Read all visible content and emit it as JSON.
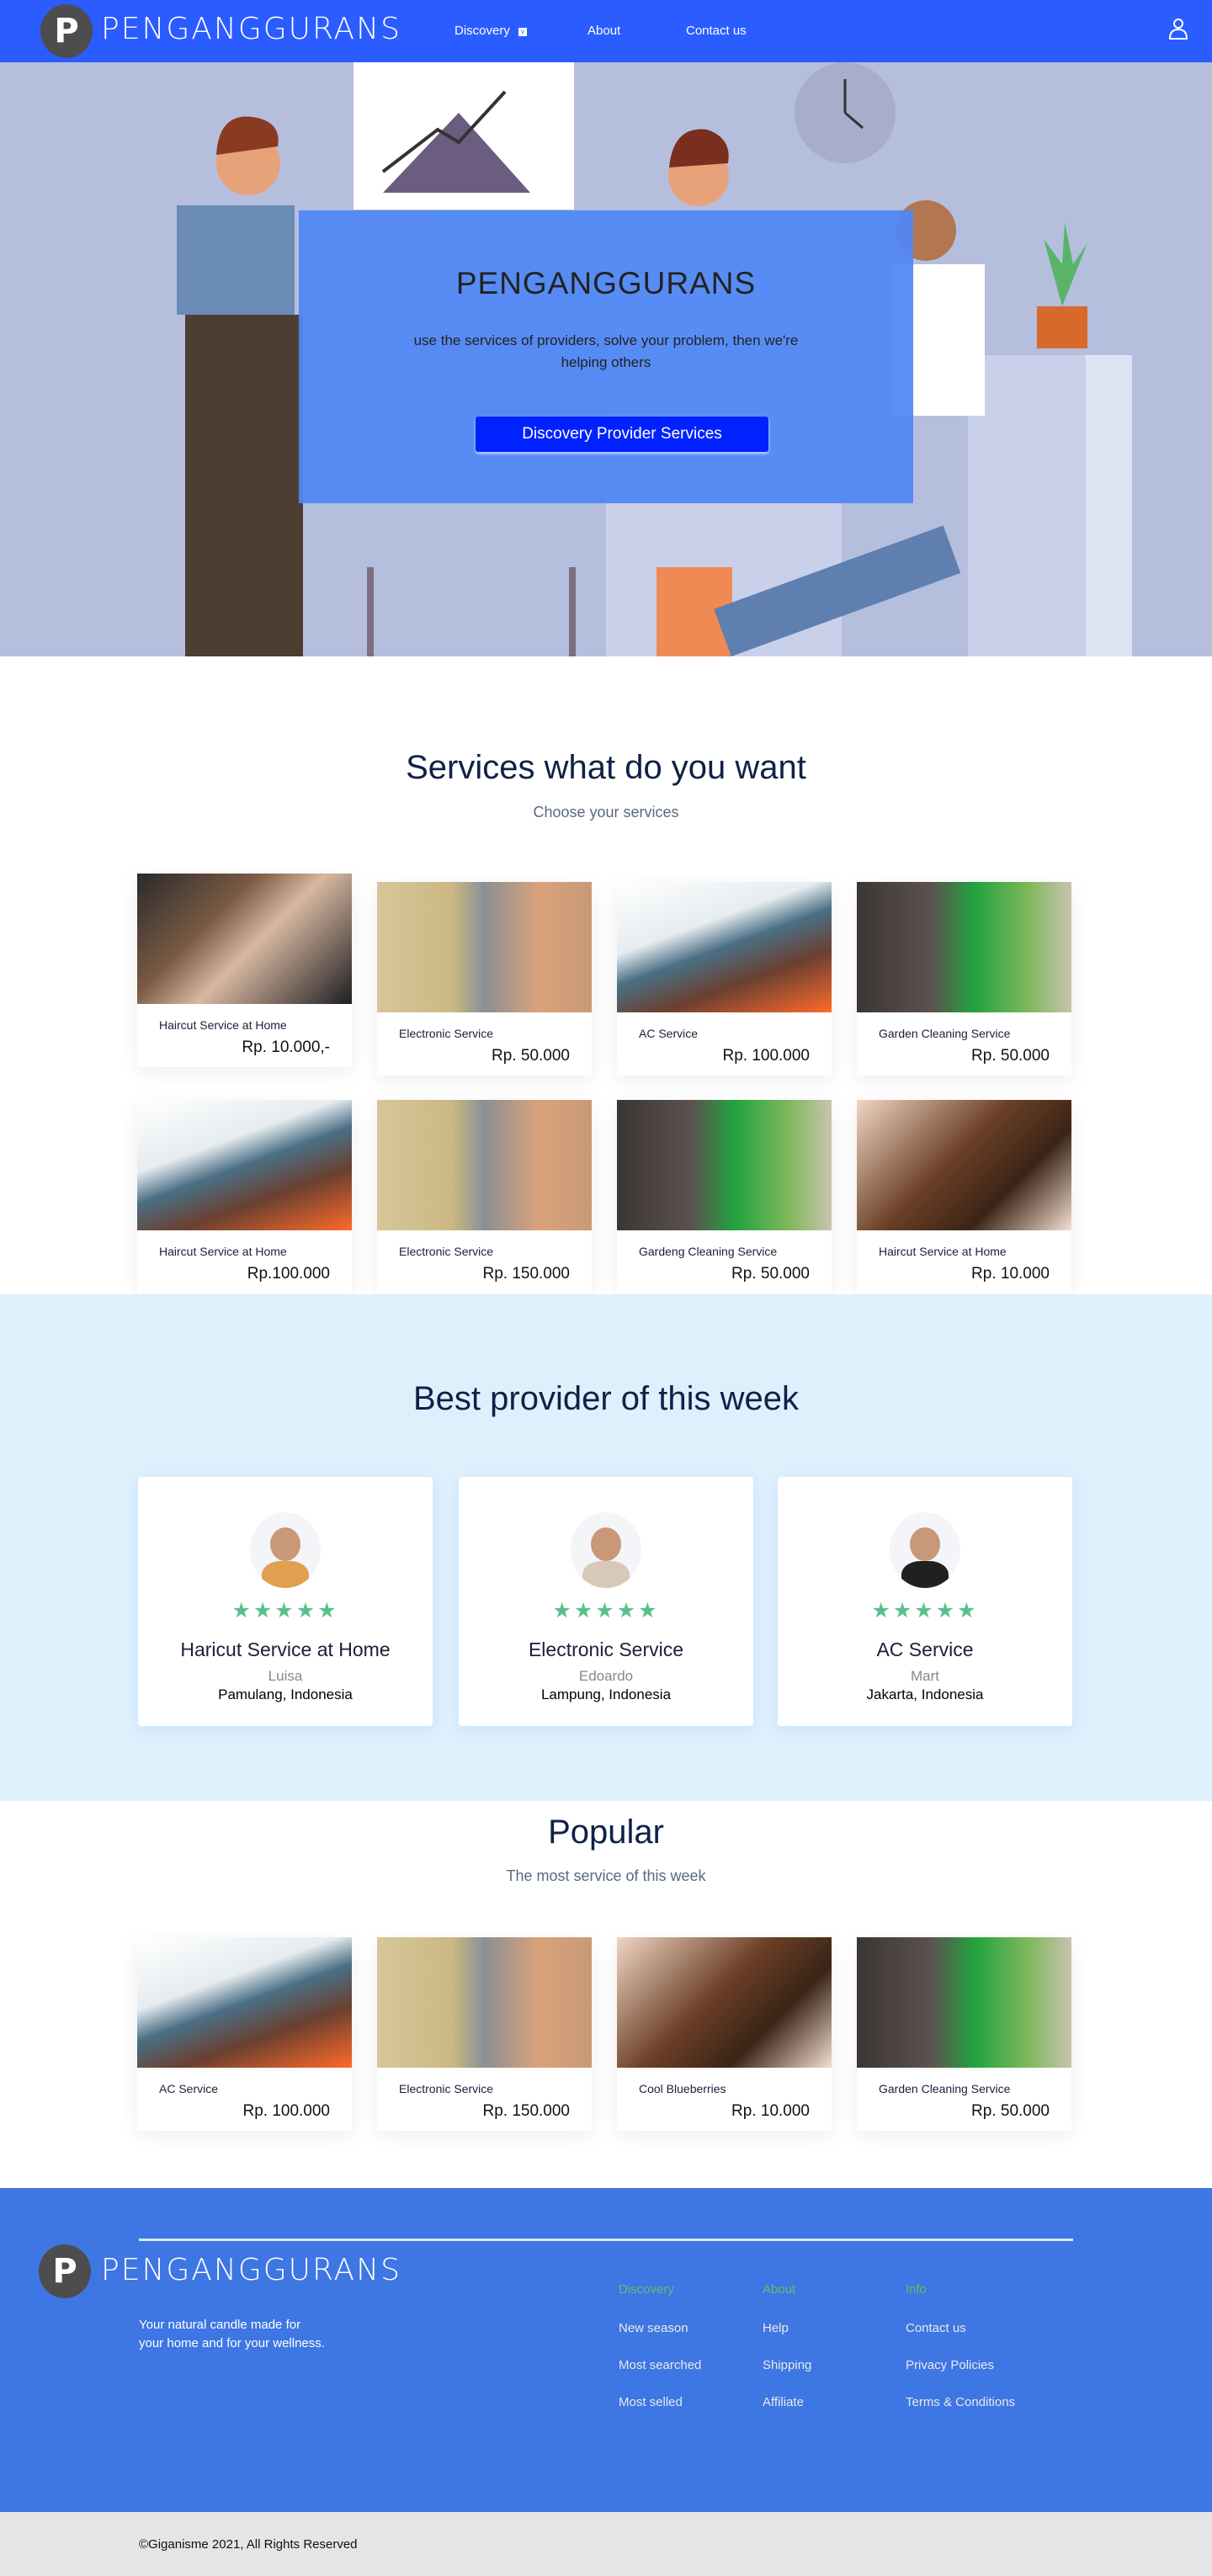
{
  "nav": {
    "brand": "PENGANGGURANS",
    "logo_letter": "P",
    "links": [
      "Discovery",
      "About",
      "Contact us"
    ],
    "dropdown_icon": "chevron-down-icon",
    "user_icon": "user-icon",
    "bg": "#2b5cff"
  },
  "hero": {
    "title": "PENGANGGURANS",
    "subtitle": "use the services of providers, solve your problem, then we're helping others",
    "button": "Discovery Provider Services"
  },
  "services": {
    "title": "Services what do you want",
    "subtitle": "Choose your services",
    "items": [
      {
        "name": "Haircut Service at Home",
        "price": "Rp. 10.000,-",
        "image": "haircut"
      },
      {
        "name": "Electronic Service",
        "price": "Rp. 50.000",
        "image": "electronic"
      },
      {
        "name": "AC Service",
        "price": "Rp. 100.000",
        "image": "ac"
      },
      {
        "name": "Garden Cleaning Service",
        "price": "Rp. 50.000",
        "image": "garden"
      },
      {
        "name": "Haircut Service at Home",
        "price": "Rp.100.000",
        "image": "ac"
      },
      {
        "name": "Electronic Service",
        "price": "Rp. 150.000",
        "image": "electronic"
      },
      {
        "name": "Gardeng Cleaning Service",
        "price": "Rp. 50.000",
        "image": "garden"
      },
      {
        "name": "Haircut Service at Home",
        "price": "Rp. 10.000",
        "image": "hair"
      }
    ]
  },
  "best": {
    "title": "Best provider of this week",
    "rating": 5,
    "star": "★",
    "providers": [
      {
        "service": "Haricut Service at Home",
        "name": "Luisa",
        "location": "Pamulang, Indonesia"
      },
      {
        "service": "Electronic Service",
        "name": "Edoardo",
        "location": "Lampung, Indonesia"
      },
      {
        "service": "AC Service",
        "name": "Mart",
        "location": "Jakarta, Indonesia"
      }
    ]
  },
  "popular": {
    "title": "Popular",
    "subtitle": "The most service of this week",
    "items": [
      {
        "name": "AC Service",
        "price": "Rp. 100.000",
        "image": "ac"
      },
      {
        "name": "Electronic Service",
        "price": "Rp. 150.000",
        "image": "electronic"
      },
      {
        "name": "Cool Blueberries",
        "price": "Rp. 10.000",
        "image": "hair"
      },
      {
        "name": "Garden Cleaning Service",
        "price": "Rp. 50.000",
        "image": "garden"
      }
    ]
  },
  "footer": {
    "brand": "PENGANGGURANS",
    "logo_letter": "P",
    "tagline_1": "Your natural candle made for",
    "tagline_2": "your home and for your wellness.",
    "columns": [
      {
        "heading": "Discovery",
        "items": [
          "New season",
          "Most searched",
          "Most selled"
        ]
      },
      {
        "heading": "About",
        "items": [
          "Help",
          "Shipping",
          "Affiliate"
        ]
      },
      {
        "heading": "Info",
        "items": [
          "Contact us",
          "Privacy Policies",
          "Terms & Conditions"
        ]
      }
    ],
    "copyright": "©Giganisme 2021, All Rights Reserved"
  }
}
